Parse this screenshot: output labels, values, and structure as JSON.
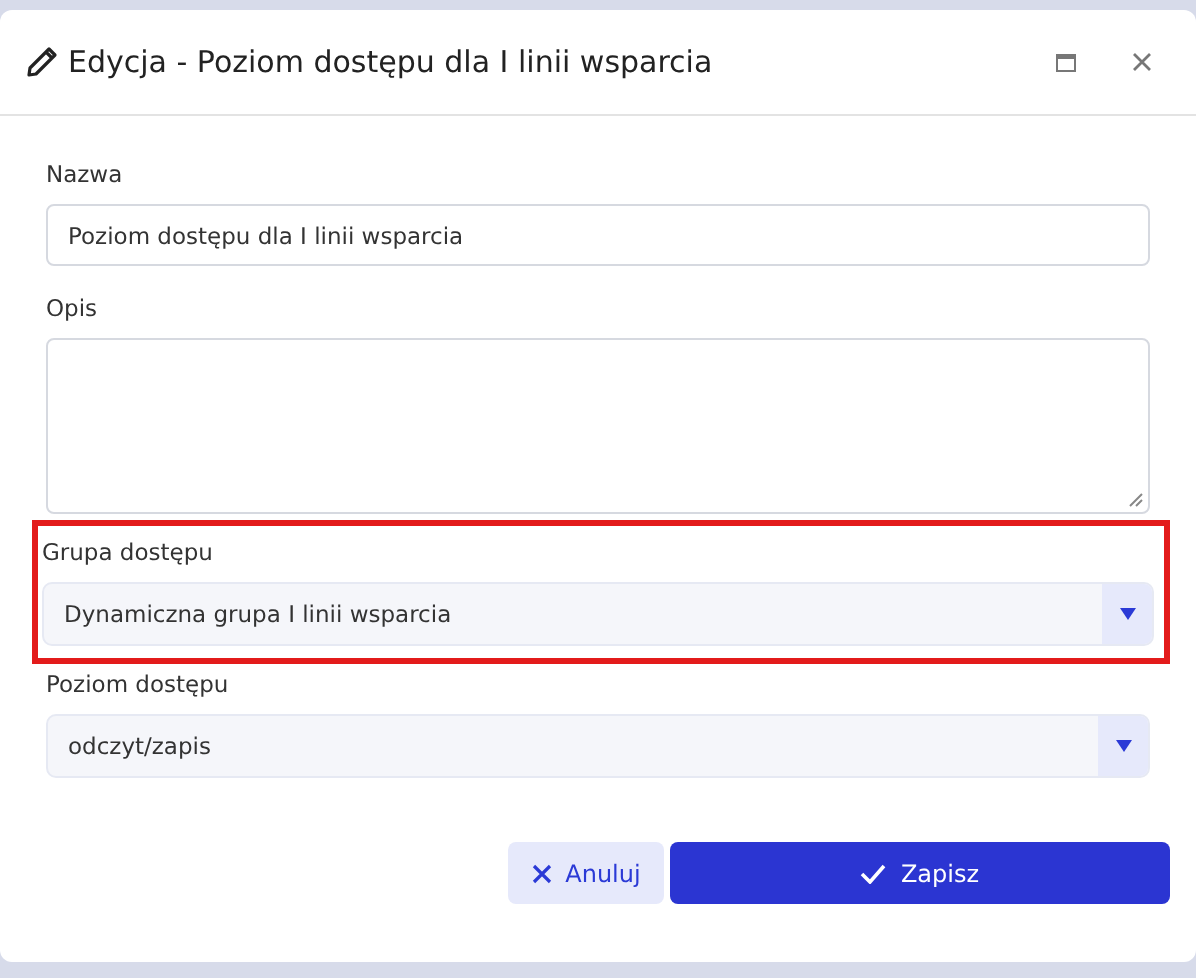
{
  "dialog": {
    "title": "Edycja - Poziom dostępu dla I linii wsparcia"
  },
  "fields": [
    {
      "kind": "text",
      "label": "Nazwa",
      "value": "Poziom dostępu dla I linii wsparcia",
      "highlighted": false
    },
    {
      "kind": "textarea",
      "label": "Opis",
      "highlighted": false
    },
    {
      "kind": "select",
      "label": "Grupa dostępu",
      "value": "Dynamiczna grupa I linii wsparcia",
      "highlighted": true
    },
    {
      "kind": "select",
      "label": "Poziom dostępu",
      "value": "odczyt/zapis",
      "highlighted": false
    }
  ],
  "buttons": [
    {
      "kind": "cancel",
      "label": "Anuluj"
    },
    {
      "kind": "save",
      "label": "Zapisz"
    }
  ]
}
